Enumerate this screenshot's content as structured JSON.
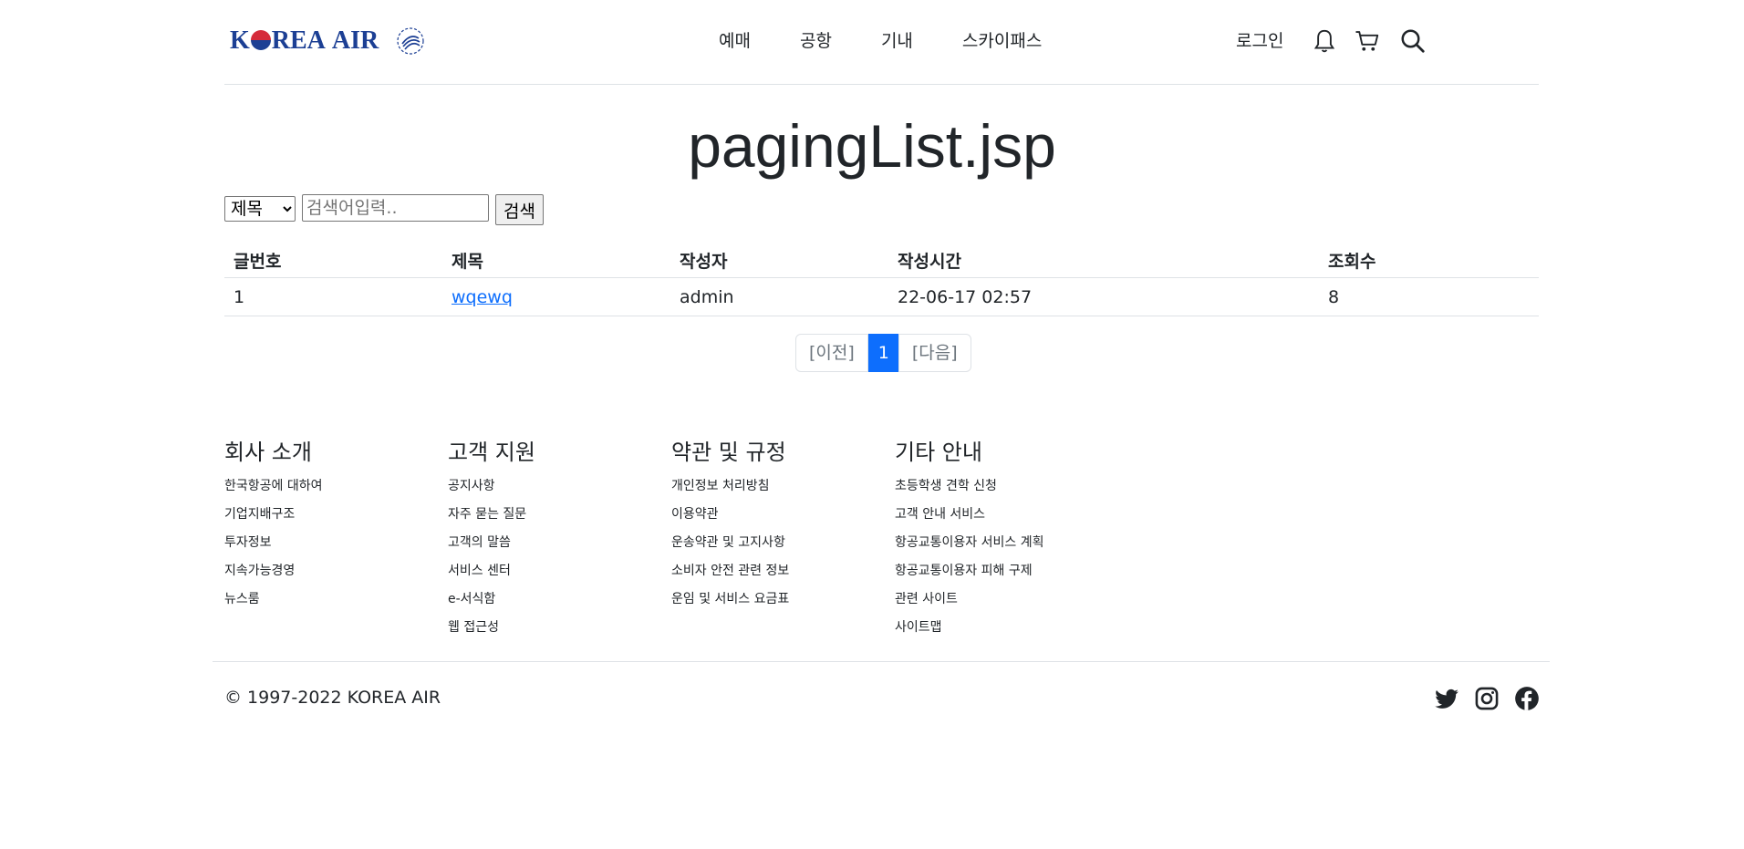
{
  "header": {
    "logo_text_1": "K",
    "logo_text_2": "REA",
    "logo_text_3": "AIR",
    "nav": [
      "예매",
      "공항",
      "기내",
      "스카이패스"
    ],
    "login": "로그인",
    "icons": [
      "bell-icon",
      "cart-icon",
      "search-icon"
    ]
  },
  "title": "pagingList.jsp",
  "search": {
    "select_value": "제목",
    "placeholder": "검색어입력..",
    "button": "검색"
  },
  "table": {
    "headers": [
      "글번호",
      "제목",
      "작성자",
      "작성시간",
      "조회수"
    ],
    "rows": [
      {
        "no": "1",
        "title": "wqewq",
        "writer": "admin",
        "time": "22-06-17 02:57",
        "views": "8"
      }
    ]
  },
  "pagination": {
    "prev": "[이전]",
    "current": "1",
    "next": "[다음]"
  },
  "footer": {
    "columns": [
      {
        "title": "회사 소개",
        "items": [
          "한국항공에 대하여",
          "기업지배구조",
          "투자정보",
          "지속가능경영",
          "뉴스룸"
        ]
      },
      {
        "title": "고객 지원",
        "items": [
          "공지사항",
          "자주 묻는 질문",
          "고객의 말씀",
          "서비스 센터",
          "e-서식함",
          "웹 접근성"
        ]
      },
      {
        "title": "약관 및 규정",
        "items": [
          "개인정보 처리방침",
          "이용약관",
          "운송약관 및 고지사항",
          "소비자 안전 관련 정보",
          "운임 및 서비스 요금표"
        ]
      },
      {
        "title": "기타 안내",
        "items": [
          "초등학생 견학 신청",
          "고객 안내 서비스",
          "항공교통이용자 서비스 계획",
          "항공교통이용자 피해 구제",
          "관련 사이트",
          "사이트맵"
        ]
      }
    ],
    "copyright": "© 1997-2022 KOREA AIR",
    "social": [
      "twitter-icon",
      "instagram-icon",
      "facebook-icon"
    ]
  },
  "colors": {
    "brand_blue": "#1c3f94",
    "brand_red": "#d52b3a",
    "accent": "#0d6efd"
  }
}
